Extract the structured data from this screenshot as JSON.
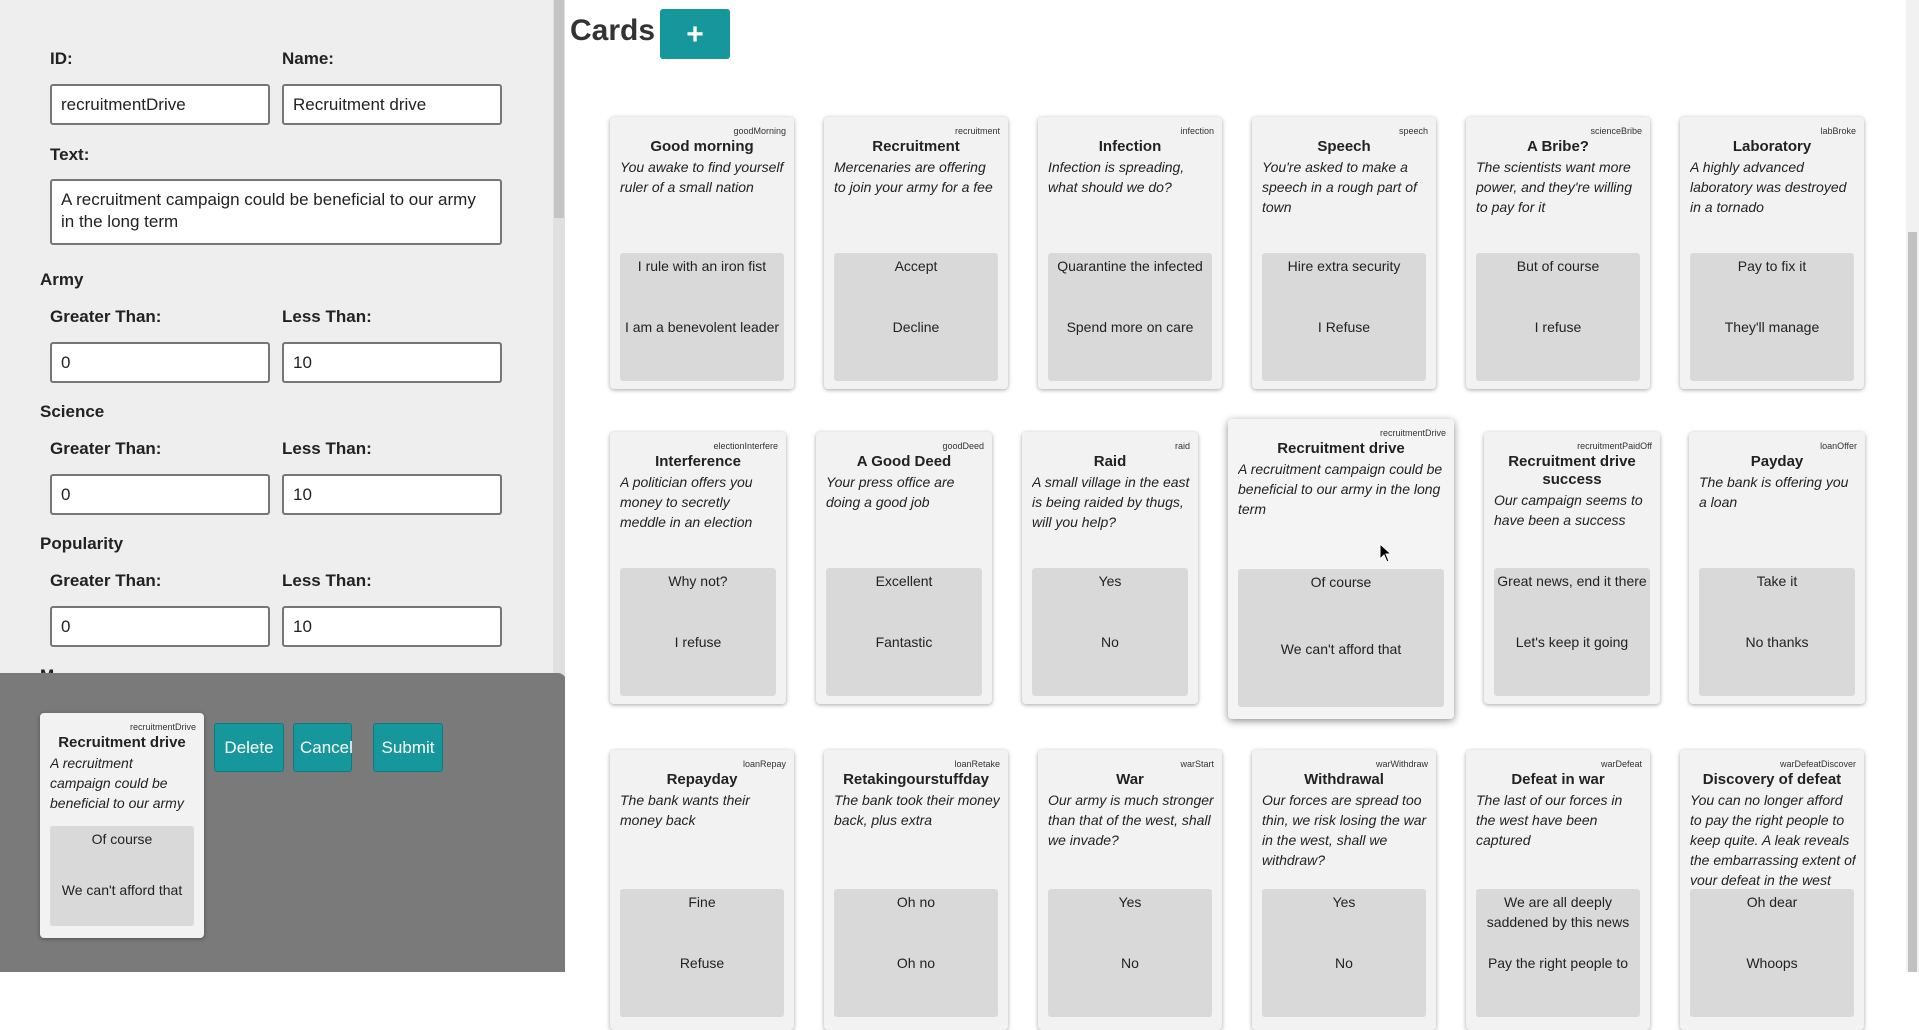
{
  "editor": {
    "id_label": "ID:",
    "id_value": "recruitmentDrive",
    "name_label": "Name:",
    "name_value": "Recruitment drive",
    "text_label": "Text:",
    "text_value": "A recruitment campaign could be beneficial to our army in the long term",
    "sections": [
      {
        "label": "Army",
        "gt_label": "Greater Than:",
        "gt_value": "0",
        "lt_label": "Less Than:",
        "lt_value": "10"
      },
      {
        "label": "Science",
        "gt_label": "Greater Than:",
        "gt_value": "0",
        "lt_label": "Less Than:",
        "lt_value": "10"
      },
      {
        "label": "Popularity",
        "gt_label": "Greater Than:",
        "gt_value": "0",
        "lt_label": "Less Than:",
        "lt_value": "10"
      },
      {
        "label": "M"
      }
    ]
  },
  "preview": {
    "card": {
      "id": "recruitmentDrive",
      "title": "Recruitment drive",
      "text": "A recruitment campaign could be beneficial to our army in the long term",
      "options": [
        "Of course",
        "We can't afford that"
      ]
    },
    "delete_label": "Delete",
    "cancel_label": "Cancel",
    "submit_label": "Submit"
  },
  "header": {
    "title": "Cards",
    "add_label": "+"
  },
  "cards": [
    [
      {
        "id": "goodMorning",
        "title": "Good morning",
        "text": "You awake to find yourself ruler of a small nation",
        "options": [
          "I rule with an iron fist",
          "I am a benevolent leader"
        ]
      },
      {
        "id": "recruitment",
        "title": "Recruitment",
        "text": "Mercenaries are offering to join your army for a fee",
        "options": [
          "Accept",
          "Decline"
        ]
      },
      {
        "id": "infection",
        "title": "Infection",
        "text": "Infection is spreading, what should we do?",
        "options": [
          "Quarantine the infected",
          "Spend more on care"
        ]
      },
      {
        "id": "speech",
        "title": "Speech",
        "text": "You're asked to make a speech in a rough part of town",
        "options": [
          "Hire extra security",
          "I Refuse"
        ]
      },
      {
        "id": "scienceBribe",
        "title": "A Bribe?",
        "text": "The scientists want more power, and they're willing to pay for it",
        "options": [
          "But of course",
          "I refuse"
        ]
      },
      {
        "id": "labBroke",
        "title": "Laboratory",
        "text": "A highly advanced laboratory was destroyed in a tornado",
        "options": [
          "Pay to fix it",
          "They'll manage"
        ]
      }
    ],
    [
      {
        "id": "electionInterfere",
        "title": "Interference",
        "text": "A politician offers you money to secretly meddle in an election",
        "options": [
          "Why not?",
          "I refuse"
        ]
      },
      {
        "id": "goodDeed",
        "title": "A Good Deed",
        "text": "Your press office are doing a good job",
        "options": [
          "Excellent",
          "Fantastic"
        ]
      },
      {
        "id": "raid",
        "title": "Raid",
        "text": "A small village in the east is being raided by thugs, will you help?",
        "options": [
          "Yes",
          "No"
        ]
      },
      {
        "id": "recruitmentDrive",
        "title": "Recruitment drive",
        "text": "A recruitment campaign could be beneficial to our army in the long term",
        "options": [
          "Of course",
          "We can't afford that"
        ]
      },
      {
        "id": "recruitmentPaidOff",
        "title": "Recruitment drive success",
        "text": "Our campaign seems to have been a success",
        "options": [
          "Great news, end it there",
          "Let's keep it going"
        ]
      },
      {
        "id": "loanOffer",
        "title": "Payday",
        "text": "The bank is offering you a loan",
        "options": [
          "Take it",
          "No thanks"
        ]
      }
    ],
    [
      {
        "id": "loanRepay",
        "title": "Repayday",
        "text": "The bank wants their money back",
        "options": [
          "Fine",
          "Refuse"
        ]
      },
      {
        "id": "loanRetake",
        "title": "Retakingourstuffday",
        "text": "The bank took their money back, plus extra",
        "options": [
          "Oh no",
          "Oh no"
        ]
      },
      {
        "id": "warStart",
        "title": "War",
        "text": "Our army is much stronger than that of the west, shall we invade?",
        "options": [
          "Yes",
          "No"
        ]
      },
      {
        "id": "warWithdraw",
        "title": "Withdrawal",
        "text": "Our forces are spread too thin, we risk losing the war in the west, shall we withdraw?",
        "options": [
          "Yes",
          "No"
        ]
      },
      {
        "id": "warDefeat",
        "title": "Defeat in war",
        "text": "The last of our forces in the west have been captured",
        "options": [
          "We are all deeply saddened by this news",
          "Pay the right people to"
        ]
      },
      {
        "id": "warDefeatDiscover",
        "title": "Discovery of defeat",
        "text": "You can no longer afford to pay the right people to keep quite. A leak reveals the embarrassing extent of your defeat in the west",
        "options": [
          "Oh dear",
          "Whoops"
        ]
      }
    ]
  ],
  "colors": {
    "accent": "#16979b",
    "panel": "#eeeeee",
    "preview_bg": "#7a7a7a",
    "card_bg": "#f2f2f2",
    "option_bg": "#d9d9d9"
  }
}
